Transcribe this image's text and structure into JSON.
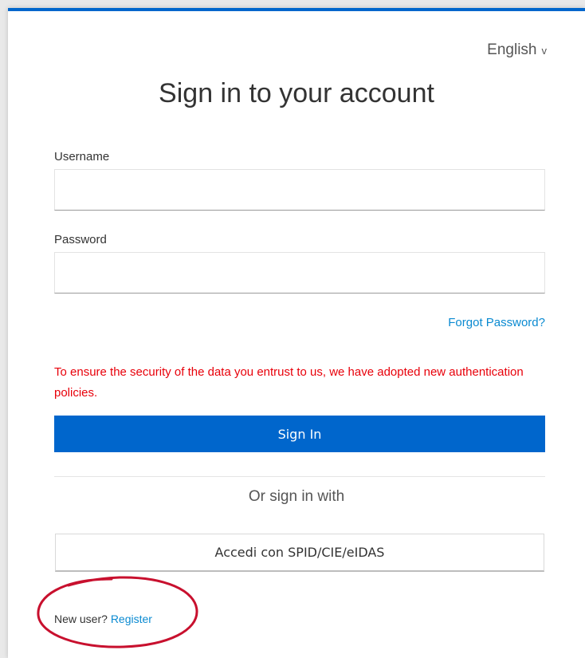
{
  "language": {
    "selected": "English",
    "chevron": "v"
  },
  "form": {
    "title": "Sign in to your account",
    "username_label": "Username",
    "username_value": "",
    "password_label": "Password",
    "password_value": "",
    "forgot_password": "Forgot Password?",
    "security_notice": "To ensure the security of the data you entrust to us, we have adopted new authentication policies.",
    "sign_in_button": "Sign In"
  },
  "alternate": {
    "or_text": "Or sign in with",
    "spid_button": "Accedi con SPID/CIE/eIDAS"
  },
  "register": {
    "prompt": "New user?",
    "link": "Register"
  },
  "colors": {
    "accent": "#0066cc",
    "link": "#0a8ad1",
    "warning": "#e8000a",
    "annotation_circle": "#c8102e"
  },
  "icons": {
    "language_chevron": "chevron-down-icon"
  }
}
